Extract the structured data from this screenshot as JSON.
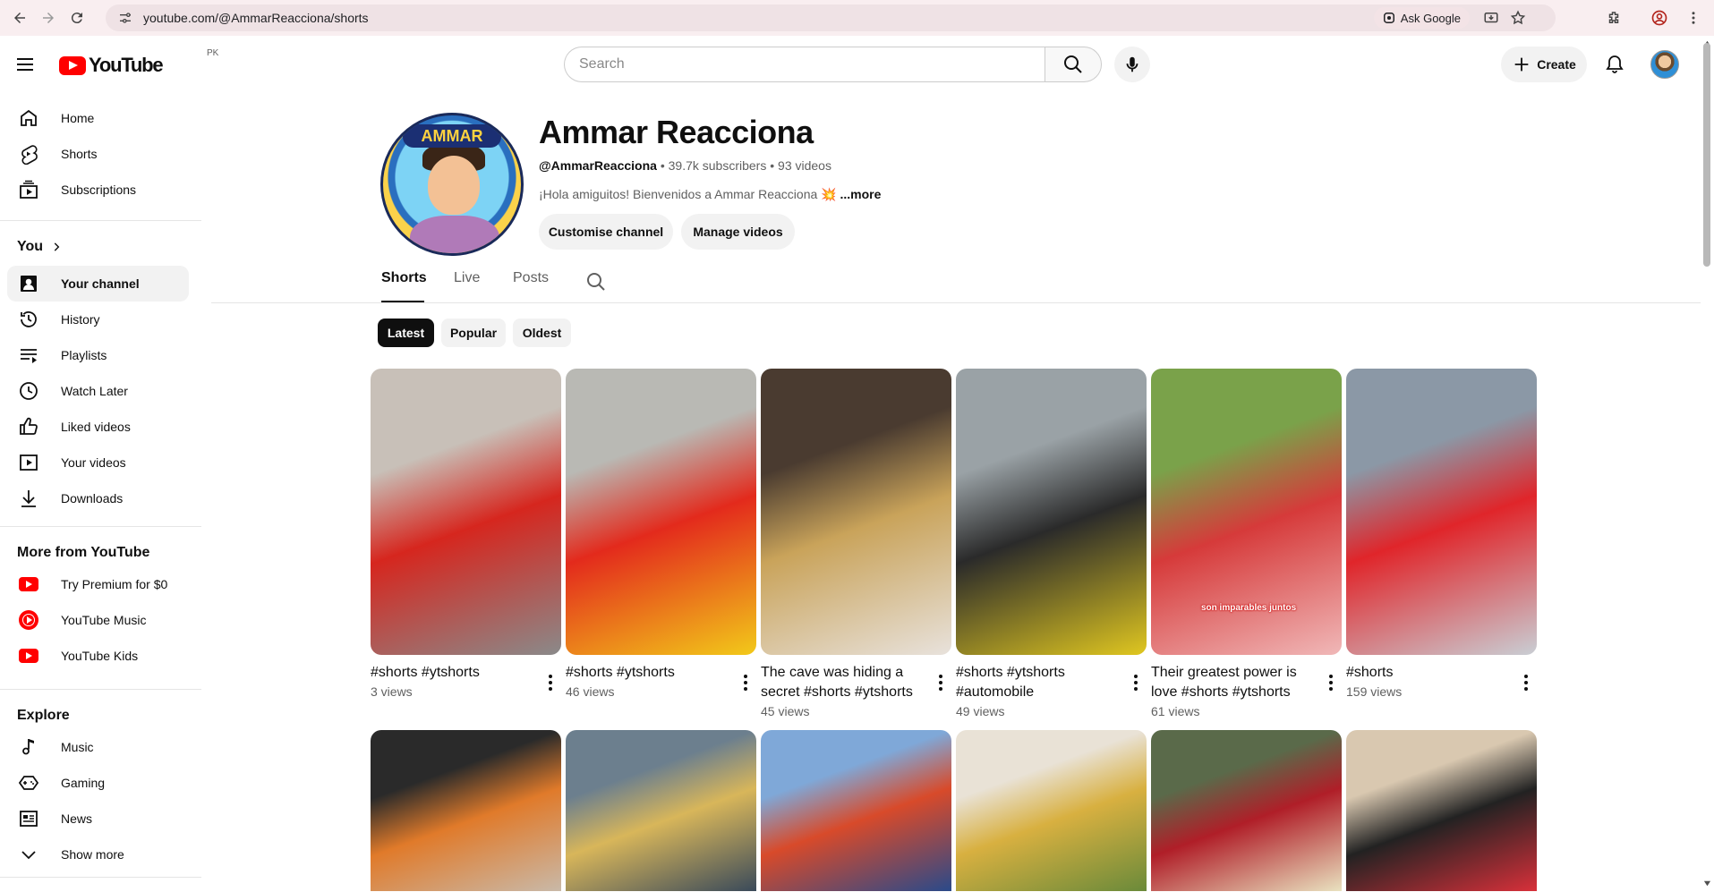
{
  "browser": {
    "url": "youtube.com/@AmmarReacciona/shorts",
    "ask_google": "Ask Google"
  },
  "masthead": {
    "logo_text": "YouTube",
    "region": "PK",
    "search_placeholder": "Search",
    "create_label": "Create"
  },
  "sidebar": {
    "main": [
      {
        "label": "Home",
        "icon": "home-icon"
      },
      {
        "label": "Shorts",
        "icon": "shorts-icon"
      },
      {
        "label": "Subscriptions",
        "icon": "subscriptions-icon"
      }
    ],
    "you_title": "You",
    "you_items": [
      {
        "label": "Your channel",
        "icon": "your-channel-icon",
        "active": true
      },
      {
        "label": "History",
        "icon": "history-icon"
      },
      {
        "label": "Playlists",
        "icon": "playlists-icon"
      },
      {
        "label": "Watch Later",
        "icon": "watch-later-icon"
      },
      {
        "label": "Liked videos",
        "icon": "like-icon"
      },
      {
        "label": "Your videos",
        "icon": "your-videos-icon"
      },
      {
        "label": "Downloads",
        "icon": "download-icon"
      }
    ],
    "more_title": "More from YouTube",
    "more_items": [
      {
        "label": "Try Premium for $0",
        "icon": "youtube-premium-icon"
      },
      {
        "label": "YouTube Music",
        "icon": "youtube-music-icon"
      },
      {
        "label": "YouTube Kids",
        "icon": "youtube-kids-icon"
      }
    ],
    "explore_title": "Explore",
    "explore_items": [
      {
        "label": "Music",
        "icon": "music-icon"
      },
      {
        "label": "Gaming",
        "icon": "gaming-icon"
      },
      {
        "label": "News",
        "icon": "news-icon"
      },
      {
        "label": "Show more",
        "icon": "chevron-down-icon"
      }
    ]
  },
  "channel": {
    "avatar_text": "AMMAR",
    "name": "Ammar Reacciona",
    "handle": "@AmmarReacciona",
    "subscribers": "39.7k subscribers",
    "videos": "93 videos",
    "description": "¡Hola amiguitos! Bienvenidos a Ammar Reacciona 💥",
    "more": "...more",
    "customise_label": "Customise channel",
    "manage_label": "Manage videos"
  },
  "tabs": [
    {
      "label": "Shorts",
      "active": true
    },
    {
      "label": "Live",
      "active": false
    },
    {
      "label": "Posts",
      "active": false
    }
  ],
  "chips": [
    {
      "label": "Latest",
      "active": true
    },
    {
      "label": "Popular",
      "active": false
    },
    {
      "label": "Oldest",
      "active": false
    }
  ],
  "shorts_row1": [
    {
      "title": "#shorts #ytshorts",
      "views": "3 views",
      "colors": [
        "#c8c0b8",
        "#d6261e",
        "#8a8a8a"
      ]
    },
    {
      "title": "#shorts #ytshorts",
      "views": "46 views",
      "colors": [
        "#b9b9b4",
        "#e32a1c",
        "#f2c91a"
      ]
    },
    {
      "title": "The cave was hiding a secret #shorts #ytshorts",
      "views": "45 views",
      "colors": [
        "#4a3b30",
        "#c9a35a",
        "#e8e2dc"
      ]
    },
    {
      "title": "#shorts #ytshorts #automobile",
      "views": "49 views",
      "colors": [
        "#9aa2a6",
        "#2a2a2a",
        "#e0c720"
      ]
    },
    {
      "title": "Their greatest power is love #shorts #ytshorts",
      "views": "61 views",
      "colors": [
        "#7aa24a",
        "#d63a3a",
        "#f0b8b8"
      ]
    },
    {
      "title": "#shorts",
      "views": "159 views",
      "colors": [
        "#8b98a6",
        "#e0252a",
        "#c9ced4"
      ]
    }
  ],
  "thumb_caption": "son imparables juntos",
  "shorts_row2": [
    {
      "colors": [
        "#2a2a2a",
        "#e07a2a",
        "#c9b9a8"
      ]
    },
    {
      "colors": [
        "#6c7f8e",
        "#d8b65a",
        "#3a4a5a"
      ]
    },
    {
      "colors": [
        "#7fa8d8",
        "#d84a2a",
        "#2a4a8a"
      ]
    },
    {
      "colors": [
        "#e9e2d6",
        "#d8b040",
        "#6a8a3a"
      ]
    },
    {
      "colors": [
        "#5a6a4a",
        "#b01e28",
        "#e9e2c0"
      ]
    },
    {
      "colors": [
        "#d9c8b0",
        "#222222",
        "#d8303a"
      ]
    }
  ]
}
